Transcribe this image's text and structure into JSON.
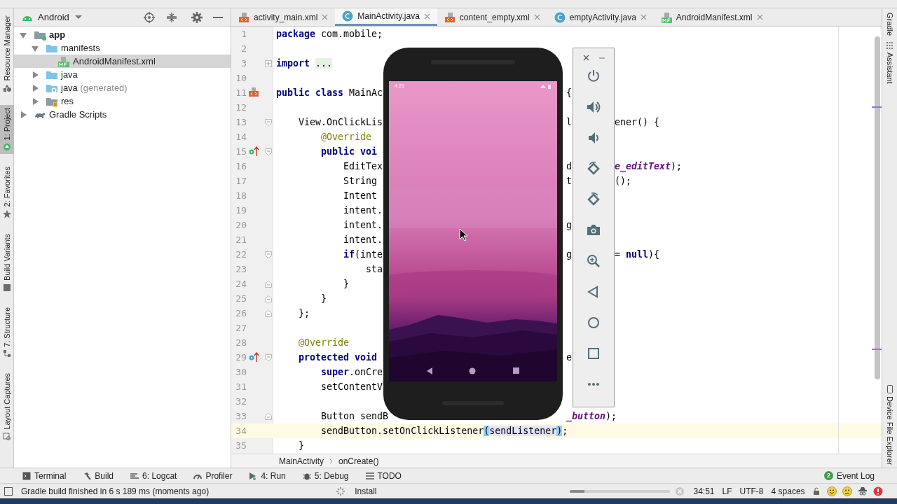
{
  "left_tool_strip": [
    {
      "label": "Resource Manager",
      "selected": false
    },
    {
      "label": "1: Project",
      "selected": true
    },
    {
      "label": "2: Favorites",
      "selected": false
    },
    {
      "label": "Build Variants",
      "selected": false
    },
    {
      "label": "7: Structure",
      "selected": false
    },
    {
      "label": "Layout Captures",
      "selected": false
    }
  ],
  "right_tool_strip": [
    {
      "label": "Gradle"
    },
    {
      "label": "Assistant"
    },
    {
      "label": "Device File Explorer"
    }
  ],
  "project_panel": {
    "view": "Android",
    "tree": [
      {
        "label": "app",
        "kind": "module",
        "expanded": true,
        "selected": false,
        "children": [
          {
            "label": "manifests",
            "kind": "folder",
            "expanded": true,
            "selected": false,
            "children": [
              {
                "label": "AndroidManifest.xml",
                "kind": "manifest",
                "selected": true
              }
            ]
          },
          {
            "label": "java",
            "kind": "folder",
            "expanded": false,
            "selected": false
          },
          {
            "label": "java",
            "note": "(generated)",
            "kind": "generated",
            "expanded": false,
            "selected": false
          },
          {
            "label": "res",
            "kind": "res",
            "expanded": false,
            "selected": false
          }
        ]
      },
      {
        "label": "Gradle Scripts",
        "kind": "gradle",
        "expanded": false,
        "selected": false
      }
    ]
  },
  "editor_tabs": [
    {
      "label": "activity_main.xml",
      "kind": "xml",
      "selected": false
    },
    {
      "label": "MainActivity.java",
      "kind": "class",
      "selected": true
    },
    {
      "label": "content_empty.xml",
      "kind": "xml",
      "selected": false
    },
    {
      "label": "emptyActivity.java",
      "kind": "class",
      "selected": false
    },
    {
      "label": "AndroidManifest.xml",
      "kind": "manifest",
      "selected": false
    }
  ],
  "code_lines": [
    {
      "number": "1",
      "current": false,
      "left": [
        {
          "text": "package",
          "kind": "keyword"
        },
        {
          "text": " com.mobile;",
          "kind": "plain"
        }
      ]
    },
    {
      "number": "2",
      "current": false
    },
    {
      "number": "3",
      "current": false,
      "left": [
        {
          "text": "import ",
          "kind": "keyword"
        },
        {
          "text": "...",
          "kind": "folded"
        }
      ]
    },
    {
      "number": "10",
      "current": false
    },
    {
      "number": "11",
      "current": false,
      "left": [
        {
          "text": "public class",
          "kind": "keyword"
        },
        {
          "text": " MainAc",
          "kind": "plain"
        }
      ],
      "mid": [
        {
          "text": "{",
          "kind": "plain"
        }
      ]
    },
    {
      "number": "12",
      "current": false
    },
    {
      "number": "13",
      "current": false,
      "left": [
        {
          "text": "    View.OnClickLis",
          "kind": "plain"
        }
      ],
      "mid": [
        {
          "text": "l",
          "kind": "plain"
        }
      ],
      "tail": [
        {
          "text": "ener() {",
          "kind": "plain"
        }
      ]
    },
    {
      "number": "14",
      "current": false,
      "left": [
        {
          "text": "        @Override",
          "kind": "annotation"
        }
      ]
    },
    {
      "number": "15",
      "current": false,
      "left": [
        {
          "text": "        public voi",
          "kind": "keyword"
        }
      ]
    },
    {
      "number": "16",
      "current": false,
      "left": [
        {
          "text": "            EditTex",
          "kind": "plain"
        }
      ],
      "mid": [
        {
          "text": "d",
          "kind": "plain"
        }
      ],
      "tail": [
        {
          "text": "e_editText",
          "kind": "field"
        },
        {
          "text": ");",
          "kind": "plain"
        }
      ]
    },
    {
      "number": "17",
      "current": false,
      "left": [
        {
          "text": "            String",
          "kind": "plain"
        }
      ],
      "mid": [
        {
          "text": "t",
          "kind": "plain"
        }
      ],
      "tail": [
        {
          "text": "();",
          "kind": "plain"
        }
      ]
    },
    {
      "number": "18",
      "current": false,
      "left": [
        {
          "text": "            Intent",
          "kind": "plain"
        }
      ]
    },
    {
      "number": "19",
      "current": false,
      "left": [
        {
          "text": "            intent.",
          "kind": "plain"
        }
      ]
    },
    {
      "number": "20",
      "current": false,
      "left": [
        {
          "text": "            intent.",
          "kind": "plain"
        }
      ],
      "mid": [
        {
          "text": "g",
          "kind": "plain"
        }
      ]
    },
    {
      "number": "21",
      "current": false,
      "left": [
        {
          "text": "            intent.",
          "kind": "plain"
        }
      ]
    },
    {
      "number": "22",
      "current": false,
      "left": [
        {
          "text": "            if",
          "kind": "keyword"
        },
        {
          "text": "(inte",
          "kind": "plain"
        }
      ],
      "mid": [
        {
          "text": "g",
          "kind": "plain"
        }
      ],
      "tail": [
        {
          "text": "= ",
          "kind": "plain"
        },
        {
          "text": "null",
          "kind": "keyword"
        },
        {
          "text": "){",
          "kind": "plain"
        }
      ]
    },
    {
      "number": "23",
      "current": false,
      "left": [
        {
          "text": "                sta",
          "kind": "plain"
        }
      ]
    },
    {
      "number": "24",
      "current": false,
      "left": [
        {
          "text": "            }",
          "kind": "plain"
        }
      ]
    },
    {
      "number": "25",
      "current": false,
      "left": [
        {
          "text": "        }",
          "kind": "plain"
        }
      ]
    },
    {
      "number": "26",
      "current": false,
      "left": [
        {
          "text": "    };",
          "kind": "plain"
        }
      ]
    },
    {
      "number": "27",
      "current": false
    },
    {
      "number": "28",
      "current": false,
      "left": [
        {
          "text": "    @Override",
          "kind": "annotation"
        }
      ]
    },
    {
      "number": "29",
      "current": false,
      "left": [
        {
          "text": "    protected void",
          "kind": "keyword"
        }
      ],
      "mid": [
        {
          "text": "e",
          "kind": "plain"
        }
      ]
    },
    {
      "number": "30",
      "current": false,
      "left": [
        {
          "text": "        super",
          "kind": "keyword"
        },
        {
          "text": ".onCre",
          "kind": "plain"
        }
      ]
    },
    {
      "number": "31",
      "current": false,
      "left": [
        {
          "text": "        setContentV",
          "kind": "plain"
        }
      ]
    },
    {
      "number": "32",
      "current": false
    },
    {
      "number": "33",
      "current": false,
      "left": [
        {
          "text": "        Button sendB",
          "kind": "plain"
        }
      ],
      "mid": [
        {
          "text": "_button",
          "kind": "field"
        },
        {
          "text": ");",
          "kind": "plain"
        }
      ]
    },
    {
      "number": "34",
      "current": true,
      "left": [
        {
          "text": "        sendButton.setOnClickListener",
          "kind": "plain"
        },
        {
          "text": "(",
          "kind": "brace_match"
        },
        {
          "text": "sendListener",
          "kind": "usage"
        },
        {
          "text": ")",
          "kind": "brace_match"
        },
        {
          "text": ";",
          "kind": "plain"
        }
      ]
    },
    {
      "number": "35",
      "current": false,
      "left": [
        {
          "text": "    }",
          "kind": "plain"
        }
      ]
    }
  ],
  "editor_breadcrumbs": [
    "MainActivity",
    "onCreate()"
  ],
  "emulator": {
    "status_time": "4:26"
  },
  "tool_windows": [
    {
      "label": "Terminal"
    },
    {
      "label": "Build"
    },
    {
      "label": "6: Logcat"
    },
    {
      "label": "Profiler"
    },
    {
      "label": "4: Run"
    },
    {
      "label": "5: Debug"
    },
    {
      "label": "TODO"
    }
  ],
  "event_log": {
    "label": "Event Log",
    "badge": "2"
  },
  "status_bar": {
    "message": "Gradle build finished in 6 s 189 ms (moments ago)",
    "task": "Install",
    "level": 0.15,
    "position": "34:51",
    "line_separator": "LF",
    "encoding": "UTF-8",
    "indent": "4 spaces"
  }
}
